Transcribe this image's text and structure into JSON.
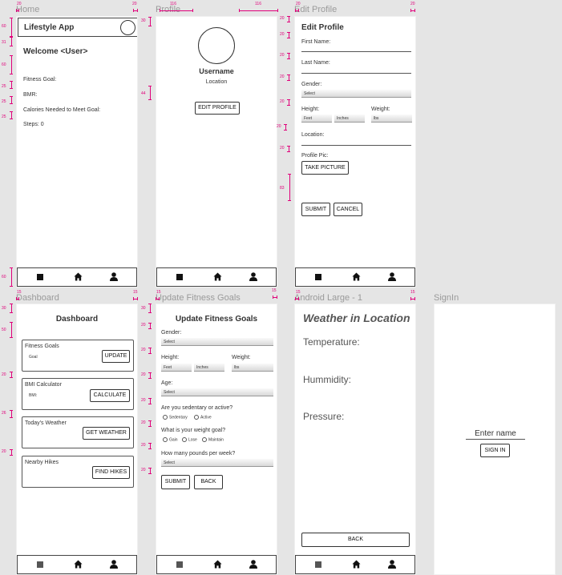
{
  "frames": {
    "home": "Home",
    "profile": "Profile",
    "edit_profile": "Edit Profile",
    "dashboard": "Dashboard",
    "update_goals": "Update Fitness Goals",
    "weather": "Android Large - 1",
    "signin": "SignIn"
  },
  "home": {
    "app_title": "Lifestyle App",
    "welcome": "Welcome <User>",
    "fitness_goal": "Fitness Goal:",
    "bmr": "BMR:",
    "calories": "Calories Needed to Meet Goal:",
    "steps": "Steps: 0"
  },
  "profile": {
    "username": "Username",
    "location": "Location",
    "edit_button": "EDIT PROFILE"
  },
  "edit_profile": {
    "title": "Edit Profile",
    "first_name": "First Name:",
    "last_name": "Last Name:",
    "gender": "Gender:",
    "gender_select": "Select",
    "height": "Height:",
    "feet": "Feet",
    "inches": "Inches",
    "weight": "Weight:",
    "lbs": "lbs",
    "location": "Location:",
    "profile_pic": "Profile Pic:",
    "take_picture": "TAKE PICTURE",
    "submit": "SUBMIT",
    "cancel": "CANCEL"
  },
  "dashboard": {
    "title": "Dashboard",
    "card1_title": "Fitness Goals",
    "card1_sub": "Goal",
    "card1_button": "UPDATE",
    "card2_title": "BMI Calculator",
    "card2_sub": "BMI:",
    "card2_button": "CALCULATE",
    "card3_title": "Today's Weather",
    "card3_button": "GET WEATHER",
    "card4_title": "Nearby Hikes",
    "card4_button": "FIND HIKES"
  },
  "update_goals": {
    "title": "Update Fitness Goals",
    "gender": "Gender:",
    "gender_select": "Select",
    "height": "Height:",
    "feet": "Feet",
    "inches": "Inches",
    "weight": "Weight:",
    "lbs": "lbs",
    "age": "Age:",
    "age_select": "Select",
    "activity_q": "Are you sedentary or active?",
    "sedentary": "Sedentary",
    "active": "Active",
    "goal_q": "What is your weight goal?",
    "gain": "Gain",
    "lose": "Lose",
    "maintain": "Maintain",
    "pounds_q": "How many pounds per week?",
    "pounds_select": "Select",
    "submit": "SUBMIT",
    "back": "BACK"
  },
  "weather": {
    "title": "Weather in Location",
    "temperature": "Temperature:",
    "humidity": "Hummidity:",
    "pressure": "Pressure:",
    "back": "BACK"
  },
  "signin": {
    "placeholder": "Enter name",
    "button": "SIGN IN"
  },
  "measurements": {
    "m20": "20",
    "m116": "116",
    "m30": "30",
    "m44": "44",
    "m60": "60",
    "m31": "31",
    "m25": "25",
    "m15": "15",
    "m50": "50",
    "m26": "26",
    "m21": "21",
    "m83": "83"
  },
  "colors": {
    "annotation": "#e0007a",
    "canvas": "#e5e5e5",
    "artboard": "#ffffff"
  }
}
